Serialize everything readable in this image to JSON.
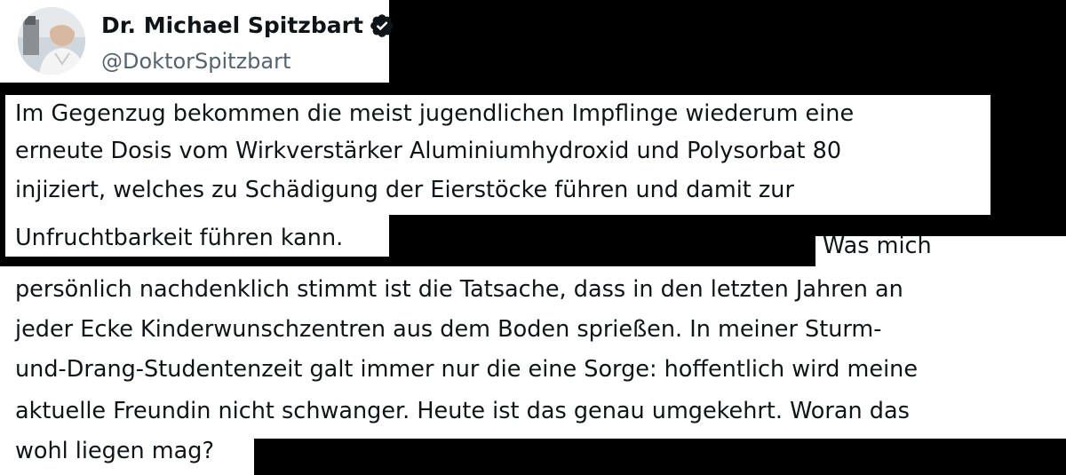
{
  "author": {
    "display_name": "Dr. Michael Spitzbart",
    "handle": "@DoktorSpitzbart",
    "verified_icon": "verified-badge-icon",
    "avatar_icon": "profile-photo"
  },
  "tweet": {
    "lines": [
      "Im Gegenzug bekommen die meist jugendlichen Impflinge wiederum eine",
      "erneute Dosis vom Wirkverstärker Aluminiumhydroxid und Polysorbat 80",
      "injiziert, welches zu Schädigung der Eierstöcke führen und damit zur",
      "Unfruchtbarkeit führen kann.",
      "Was mich",
      "persönlich nachdenklich stimmt ist die Tatsache, dass in den letzten Jahren an",
      "jeder Ecke Kinderwunschzentren aus dem Boden sprießen. In meiner Sturm-",
      "und-Drang-Studentenzeit galt immer nur die eine Sorge: hoffentlich wird meine",
      "aktuelle Freundin nicht schwanger. Heute ist das genau umgekehrt. Woran das",
      "wohl liegen mag?"
    ]
  },
  "colors": {
    "text": "#0f1419",
    "secondary_text": "#536471",
    "redaction": "#000000",
    "background": "#ffffff"
  }
}
